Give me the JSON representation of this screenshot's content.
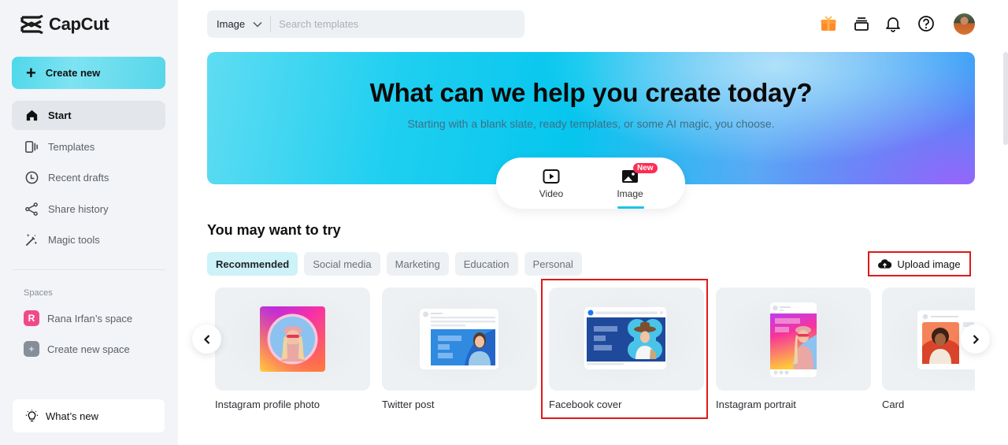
{
  "app": {
    "name": "CapCut"
  },
  "sidebar": {
    "create_label": "Create new",
    "nav": [
      {
        "label": "Start",
        "icon": "home-icon",
        "active": true
      },
      {
        "label": "Templates",
        "icon": "templates-icon"
      },
      {
        "label": "Recent drafts",
        "icon": "clock-icon"
      },
      {
        "label": "Share history",
        "icon": "share-icon"
      },
      {
        "label": "Magic tools",
        "icon": "magic-wand-icon"
      }
    ],
    "spaces_label": "Spaces",
    "spaces": [
      {
        "label": "Rana Irfan’s space",
        "badge": "R",
        "color": "#f0498a"
      },
      {
        "label": "Create new space",
        "badge": "+",
        "color": "#868e99"
      }
    ],
    "whats_new": "What’s new"
  },
  "topbar": {
    "search_type": "Image",
    "search_placeholder": "Search templates",
    "icons": [
      "gift-icon",
      "stack-icon",
      "bell-icon",
      "help-icon",
      "avatar"
    ]
  },
  "hero": {
    "title": "What can we help you create today?",
    "subtitle": "Starting with a blank slate, ready templates, or some AI magic, you choose.",
    "modes": [
      {
        "label": "Video",
        "icon": "video-icon"
      },
      {
        "label": "Image",
        "icon": "image-icon",
        "active": true,
        "badge": "New"
      }
    ]
  },
  "section": {
    "title": "You may want to try",
    "chips": [
      {
        "label": "Recommended",
        "active": true
      },
      {
        "label": "Social media"
      },
      {
        "label": "Marketing"
      },
      {
        "label": "Education"
      },
      {
        "label": "Personal"
      }
    ],
    "upload_label": "Upload image",
    "cards": [
      {
        "label": "Instagram profile photo"
      },
      {
        "label": "Twitter post"
      },
      {
        "label": "Facebook cover",
        "highlighted": true
      },
      {
        "label": "Instagram portrait"
      },
      {
        "label": "Card"
      }
    ]
  },
  "colors": {
    "accent": "#1cc5e4",
    "highlight": "#e01818",
    "new_badge": "#fe2c55"
  }
}
